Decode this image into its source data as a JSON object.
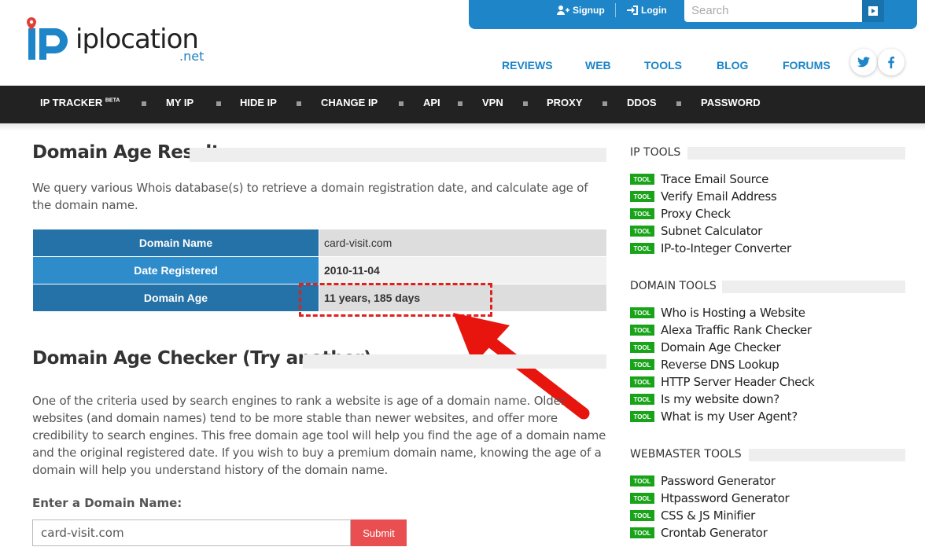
{
  "brand": {
    "name": "iplocation",
    "tld": ".net",
    "logo_letters": "IP"
  },
  "topbar": {
    "signup": "Signup",
    "login": "Login",
    "search_placeholder": "Search"
  },
  "mainnav": [
    "REVIEWS",
    "WEB",
    "TOOLS",
    "BLOG",
    "FORUMS"
  ],
  "social": {
    "twitter": "t",
    "facebook": "f"
  },
  "darknav": {
    "items": [
      "IP TRACKER",
      "MY IP",
      "HIDE IP",
      "CHANGE IP",
      "API",
      "VPN",
      "PROXY",
      "DDOS",
      "PASSWORD"
    ],
    "beta": "BETA"
  },
  "result": {
    "title": "Domain Age Result",
    "intro": "We query various Whois database(s) to retrieve a domain registration date, and calculate age of the domain name.",
    "rows": [
      {
        "label": "Domain Name",
        "value": "card-visit.com"
      },
      {
        "label": "Date Registered",
        "value": "2010-11-04"
      },
      {
        "label": "Domain Age",
        "value": "11 years, 185 days"
      }
    ]
  },
  "checker": {
    "title": "Domain Age Checker (Try another)",
    "body": "One of the criteria used by search engines to rank a website is age of a domain name. Older websites (and domain names) tend to be more stable than newer websites, and offer more credibility to search engines. This free domain age tool will help you find the age of a domain name and the original registered date. If you wish to buy a premium domain name, knowing the age of a domain will help you understand history of the domain name.",
    "input_label": "Enter a Domain Name:",
    "input_value": "card-visit.com",
    "submit": "Submit"
  },
  "sidebar": {
    "badge": "TOOL",
    "ip_tools": {
      "title": "IP TOOLS",
      "items": [
        "Trace Email Source",
        "Verify Email Address",
        "Proxy Check",
        "Subnet Calculator",
        "IP-to-Integer Converter"
      ]
    },
    "domain_tools": {
      "title": "DOMAIN TOOLS",
      "items": [
        "Who is Hosting a Website",
        "Alexa Traffic Rank Checker",
        "Domain Age Checker",
        "Reverse DNS Lookup",
        "HTTP Server Header Check",
        "Is my website down?",
        "What is my User Agent?"
      ]
    },
    "webmaster_tools": {
      "title": "WEBMASTER TOOLS",
      "items": [
        "Password Generator",
        "Htpassword Generator",
        "CSS & JS Minifier",
        "Crontab Generator"
      ]
    }
  },
  "colors": {
    "primary": "#1d85c8",
    "table_key_dark": "#2472a7",
    "table_key_light": "#2f8ccb",
    "table_val_grey": "#ddd",
    "table_val_light": "#f1f1f1",
    "badge": "#18a318",
    "submit": "#e94f50",
    "annotation": "#e0201c"
  },
  "icons": [
    "logo-pin-icon",
    "add-user-icon",
    "sign-in-icon",
    "search-go-icon",
    "twitter-icon",
    "facebook-icon",
    "annotation-arrow"
  ]
}
